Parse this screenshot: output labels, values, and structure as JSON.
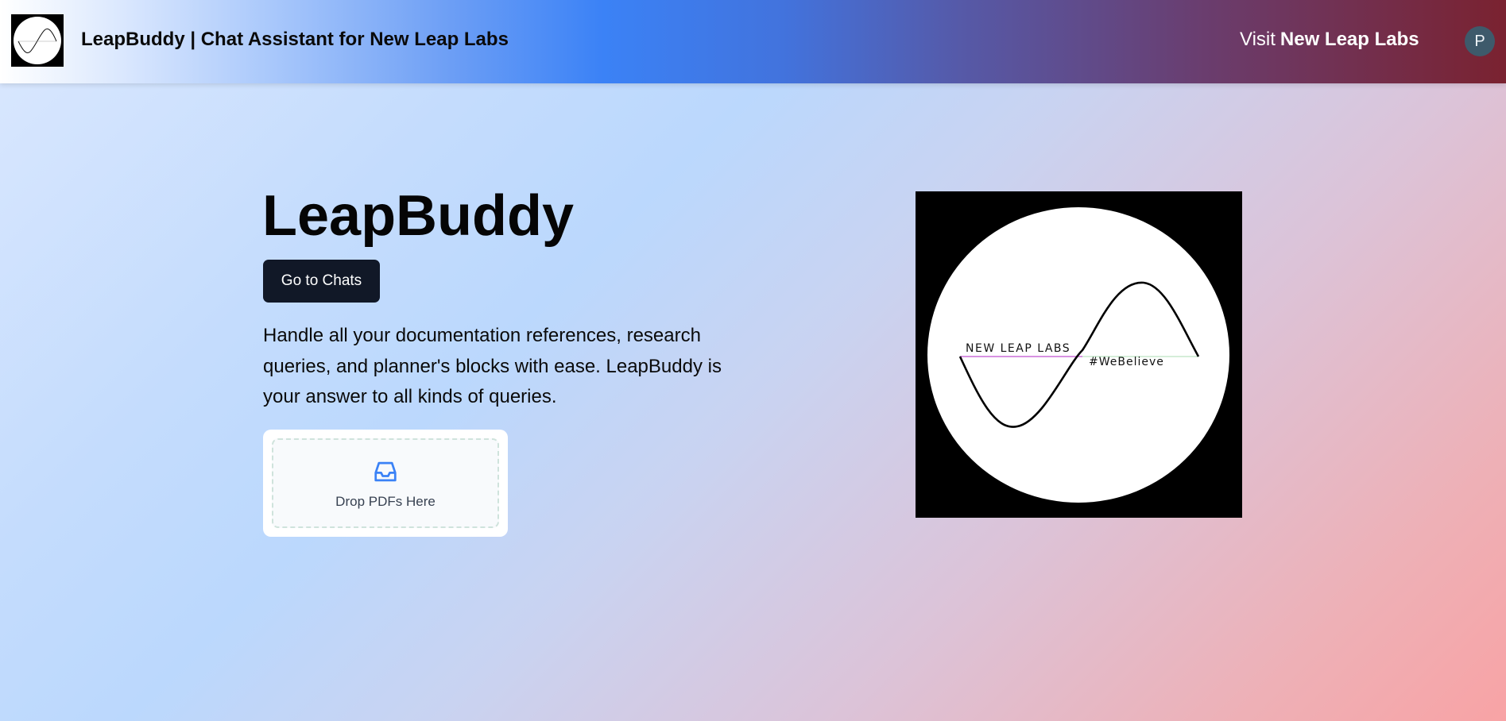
{
  "header": {
    "title": "LeapBuddy | Chat Assistant for New Leap Labs",
    "visit_word": "Visit",
    "visit_brand": "New Leap Labs",
    "avatar_initial": "P"
  },
  "hero": {
    "title": "LeapBuddy",
    "cta_label": "Go to Chats",
    "description": "Handle all your documentation references, research queries, and planner's blocks with ease. LeapBuddy is your answer to all kinds of queries."
  },
  "dropzone": {
    "label": "Drop PDFs Here",
    "icon": "inbox-icon"
  },
  "brand_image": {
    "logo_text": "NEW LEAP LABS",
    "tagline": "#WeBelieve"
  },
  "colors": {
    "button_bg": "#111827",
    "accent_blue": "#3b82f6",
    "header_end": "#7a2230",
    "avatar_bg": "#3e5a6b"
  }
}
